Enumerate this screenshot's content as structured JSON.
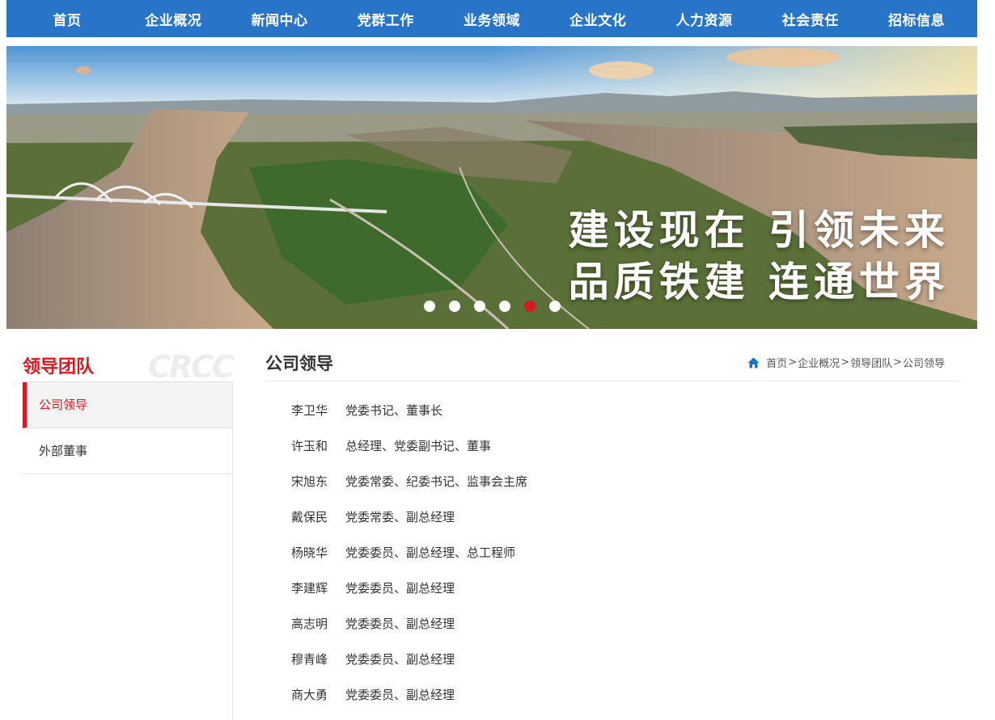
{
  "nav": {
    "items": [
      "首页",
      "企业概况",
      "新闻中心",
      "党群工作",
      "业务领域",
      "企业文化",
      "人力资源",
      "社会责任",
      "招标信息"
    ]
  },
  "banner": {
    "line1": "建设现在  引领未来",
    "line2": "品质铁建  连通世界",
    "dots": 6,
    "active_dot": 4
  },
  "sidebar": {
    "title": "领导团队",
    "logo_text": "CRCC",
    "items": [
      {
        "label": "公司领导",
        "active": true
      },
      {
        "label": "外部董事",
        "active": false
      }
    ]
  },
  "content": {
    "title": "公司领导",
    "breadcrumb": [
      "首页",
      "企业概况",
      "领导团队",
      "公司领导"
    ],
    "breadcrumb_sep": ">",
    "leaders": [
      {
        "name": "李卫华",
        "title": "党委书记、董事长"
      },
      {
        "name": "许玉和",
        "title": "总经理、党委副书记、董事"
      },
      {
        "name": "宋旭东",
        "title": "党委常委、纪委书记、监事会主席"
      },
      {
        "name": "戴保民",
        "title": "党委常委、副总经理"
      },
      {
        "name": "杨晓华",
        "title": "党委委员、副总经理、总工程师"
      },
      {
        "name": "李建辉",
        "title": "党委委员、副总经理"
      },
      {
        "name": "高志明",
        "title": "党委委员、副总经理"
      },
      {
        "name": "穆青峰",
        "title": "党委委员、副总经理"
      },
      {
        "name": "商大勇",
        "title": "党委委员、副总经理"
      }
    ]
  },
  "colors": {
    "nav_bg": "#2874c8",
    "accent_red": "#d7181f",
    "home_icon": "#1a73c8"
  }
}
